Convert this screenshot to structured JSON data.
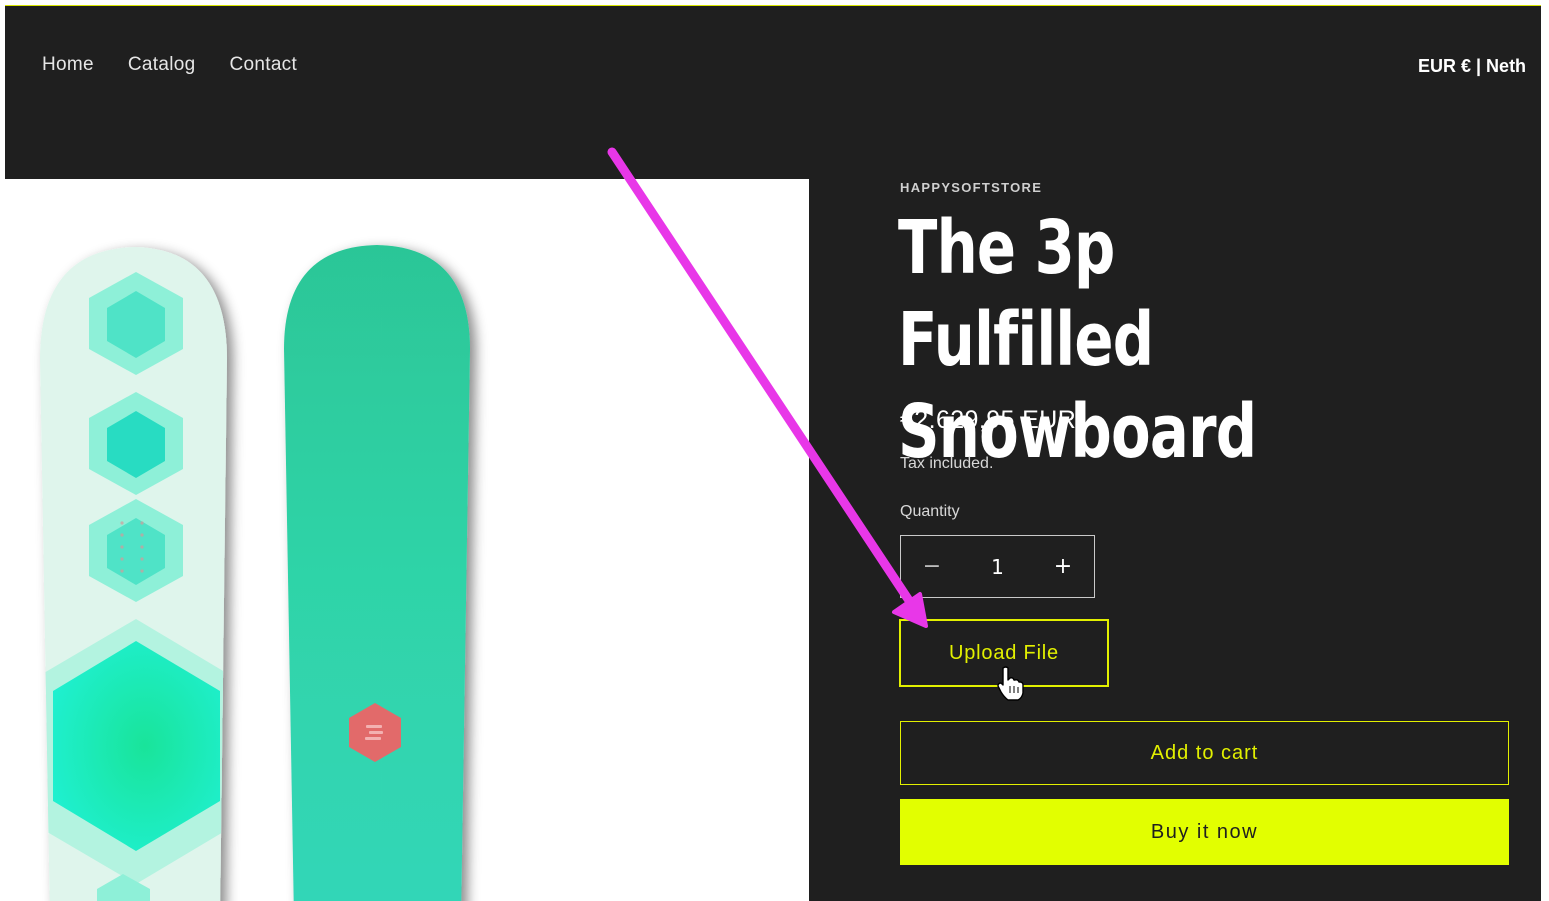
{
  "nav": {
    "items": [
      {
        "label": "Home"
      },
      {
        "label": "Catalog"
      },
      {
        "label": "Contact"
      }
    ]
  },
  "header": {
    "currency": "EUR € | Neth"
  },
  "product": {
    "vendor": "HAPPYSOFTSTORE",
    "title": "The 3p Fulfilled Snowboard",
    "price": "€2.629,95 EUR",
    "tax_note": "Tax included.",
    "quantity_label": "Quantity",
    "quantity_value": "1",
    "decrease_symbol": "−",
    "increase_symbol": "+",
    "upload_label": "Upload File",
    "add_to_cart_label": "Add to cart",
    "buy_now_label": "Buy it now"
  },
  "colors": {
    "background": "#1f1f1f",
    "accent": "#e2ff00",
    "annotation_arrow": "#e837e8",
    "board_mint": "#dff5ec",
    "board_teal": "#2fd2a6"
  },
  "icons": {
    "cursor": "hand-pointer-icon",
    "arrow": "annotation-arrow-icon"
  }
}
